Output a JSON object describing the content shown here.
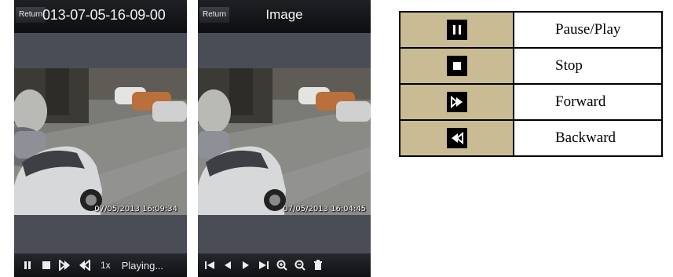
{
  "left_screen": {
    "return_label": "Return",
    "title": "013-07-05-16-09-00",
    "video_timestamp": "07/05/2013 16:09:34",
    "speed": "1x",
    "status": "Playing...",
    "controls": [
      "pause-icon",
      "stop-icon",
      "forward-icon",
      "backward-icon"
    ]
  },
  "right_screen": {
    "return_label": "Return",
    "title": "Image",
    "video_timestamp": "07/05/2013 16:04:45",
    "controls": [
      "first-icon",
      "previous-icon",
      "next-icon",
      "last-icon",
      "zoom-in-icon",
      "zoom-out-icon",
      "delete-icon"
    ]
  },
  "legend": {
    "rows": [
      {
        "icon": "pause-play-icon",
        "label": "Pause/Play"
      },
      {
        "icon": "stop-icon",
        "label": "Stop"
      },
      {
        "icon": "forward-icon",
        "label": "Forward"
      },
      {
        "icon": "backward-icon",
        "label": "Backward"
      }
    ]
  },
  "colors": {
    "legend_icon_cell": "#c9bc95",
    "phone_background": "#4a4d56",
    "bar_background": "#0f1012"
  }
}
